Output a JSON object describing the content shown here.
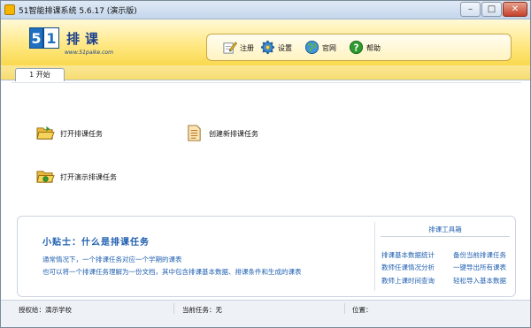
{
  "window": {
    "title": "51智能排课系统 5.6.17 (演示版)",
    "controls": {
      "minimize": "–",
      "maximize": "□",
      "close": "✕"
    }
  },
  "header": {
    "logo_digit1": "5",
    "logo_digit2": "1",
    "logo_title": "排课",
    "logo_url": "www.51paike.com"
  },
  "toolbar": {
    "register": "注册",
    "settings": "设置",
    "website": "官网",
    "help": "帮助"
  },
  "tabs": [
    {
      "label": "1 开始"
    }
  ],
  "actions": {
    "open_task": "打开排课任务",
    "create_task": "创建新排课任务",
    "open_demo": "打开演示排课任务"
  },
  "tips": {
    "title": "小贴士：什么是排课任务",
    "lines": [
      "通常情况下，一个排课任务对应一个学期的课表",
      "也可以将一个排课任务理解为一份文档，其中包含排课基本数据、排课条件和生成的课表"
    ]
  },
  "tools": {
    "title": "排课工具箱",
    "items": [
      "排课基本数据统计",
      "备份当前排课任务",
      "教师任课情况分析",
      "一键导出所有课表",
      "教师上课时间查询",
      "轻松导入基本数据"
    ]
  },
  "status": {
    "license": "授权给：演示学校",
    "current_task": "当前任务：无",
    "position": "位置："
  },
  "colors": {
    "accent_blue": "#1f5fb0",
    "banner_yellow": "#ffe884",
    "title_bar": "#c4d6ec"
  },
  "icons": {
    "register": "register-pencil-icon",
    "settings": "gear-icon",
    "website": "globe-icon",
    "help": "help-icon",
    "open_task": "open-folder-icon",
    "create_task": "new-document-icon",
    "open_demo": "demo-folder-icon"
  }
}
